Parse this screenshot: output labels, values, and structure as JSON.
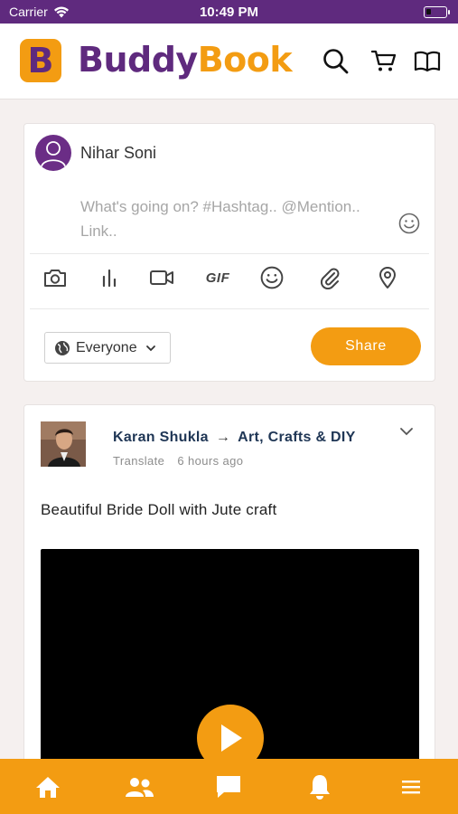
{
  "status_bar": {
    "carrier": "Carrier",
    "time": "10:49 PM"
  },
  "header": {
    "logo_letter": "B",
    "brand_part1": "Buddy",
    "brand_part2": "Book",
    "icons": [
      "search-icon",
      "cart-icon",
      "book-icon"
    ]
  },
  "composer": {
    "user_name": "Nihar Soni",
    "placeholder": "What's going on? #Hashtag.. @Mention.. Link..",
    "tools": [
      "camera-icon",
      "poll-icon",
      "video-icon",
      "gif-icon",
      "emoji-icon",
      "attachment-icon",
      "location-icon"
    ],
    "gif_label": "GIF",
    "audience_label": "Everyone",
    "share_label": "Share"
  },
  "post": {
    "author": "Karan Shukla",
    "arrow": "→",
    "group": "Art, Crafts & DIY",
    "translate_label": "Translate",
    "time_ago": "6 hours ago",
    "text": "Beautiful Bride Doll with Jute craft"
  },
  "bottom_nav": {
    "items": [
      "home-icon",
      "friends-icon",
      "messages-icon",
      "notifications-icon",
      "menu-icon"
    ]
  },
  "colors": {
    "brand_purple": "#5f2a7e",
    "brand_orange": "#f39c12",
    "author_blue": "#1f3655"
  }
}
